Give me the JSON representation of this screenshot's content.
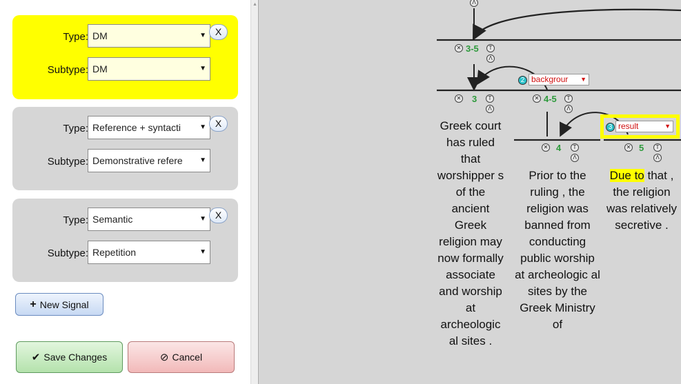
{
  "signals": [
    {
      "type_label": "Type:",
      "type_value": "DM",
      "subtype_label": "Subtype:",
      "subtype_value": "DM",
      "close": "X"
    },
    {
      "type_label": "Type:",
      "type_value": "Reference + syntacti",
      "subtype_label": "Subtype:",
      "subtype_value": "Demonstrative refere",
      "close": "X"
    },
    {
      "type_label": "Type:",
      "type_value": "Semantic",
      "subtype_label": "Subtype:",
      "subtype_value": "Repetition",
      "close": "X"
    }
  ],
  "buttons": {
    "new_signal": "New Signal",
    "save": "Save Changes",
    "cancel": "Cancel"
  },
  "tree": {
    "spans": {
      "s35": "3-5",
      "s3": "3",
      "s45": "4-5",
      "s4": "4",
      "s5": "5"
    },
    "relations": {
      "r2": {
        "num": "2",
        "label": "backgrour"
      },
      "r3": {
        "num": "3",
        "label": "result"
      }
    },
    "edus": {
      "e3": "Greek court has ruled that worshipper s of the ancient Greek religion may now formally associate and worship at archeologic al sites .",
      "e4": "Prior to the ruling , the religion was banned from conducting public worship at archeologic al sites by the Greek Ministry of",
      "e5_highlight": "Due to",
      "e5_rest": "that , the religion was relatively secretive ."
    }
  },
  "colors": {
    "active_signal": "#ffff00",
    "inactive_signal": "#d6d6d6",
    "span_label": "#2e9a3c",
    "relation_text": "#d01010",
    "node_badge": "#29c0c9"
  }
}
